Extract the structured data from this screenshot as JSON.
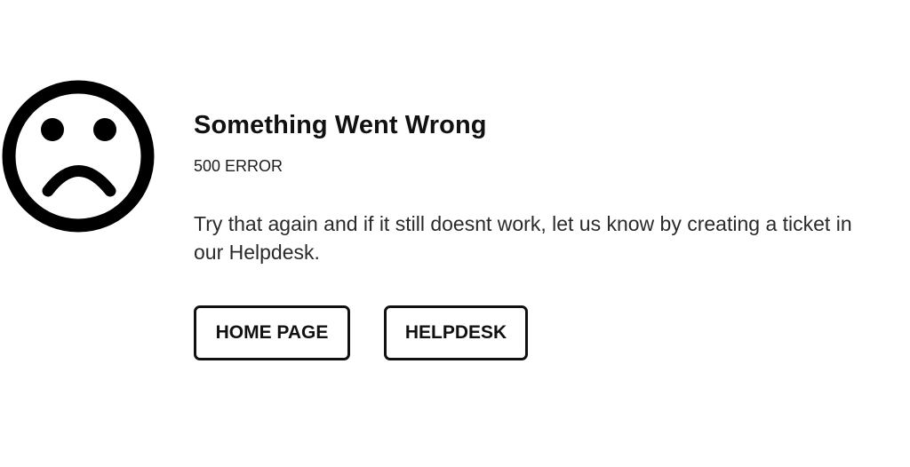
{
  "error": {
    "icon": "sad-face-icon",
    "title": "Something Went Wrong",
    "code": "500 ERROR",
    "message": "Try that again and if it still doesnt work, let us know by creating a ticket in our Helpdesk."
  },
  "actions": {
    "home_label": "HOME PAGE",
    "helpdesk_label": "HELPDESK"
  },
  "colors": {
    "text": "#111111",
    "background": "#ffffff"
  }
}
